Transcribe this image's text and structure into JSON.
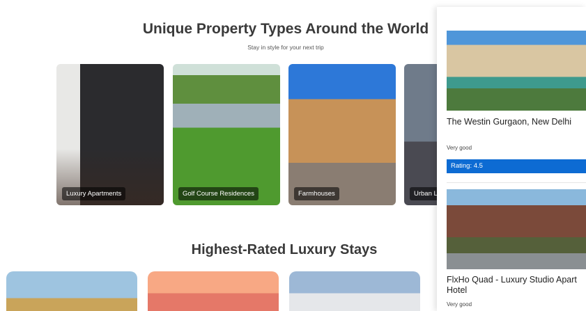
{
  "sections": {
    "property_types": {
      "title": "Unique Property Types Around the World",
      "subtitle": "Stay in style for your next trip",
      "cards": [
        {
          "label": "Luxury Apartments"
        },
        {
          "label": "Golf Course Residences"
        },
        {
          "label": "Farmhouses"
        },
        {
          "label": "Urban Lo"
        }
      ]
    },
    "luxury_stays": {
      "title": "Highest-Rated Luxury Stays"
    }
  },
  "side_panel": {
    "hotels": [
      {
        "name": "The Westin Gurgaon, New Delhi",
        "review": "Very good",
        "rating": "Rating: 4.5"
      },
      {
        "name": "FlxHo Quad - Luxury Studio Apart Hotel",
        "review": "Very good"
      }
    ]
  }
}
